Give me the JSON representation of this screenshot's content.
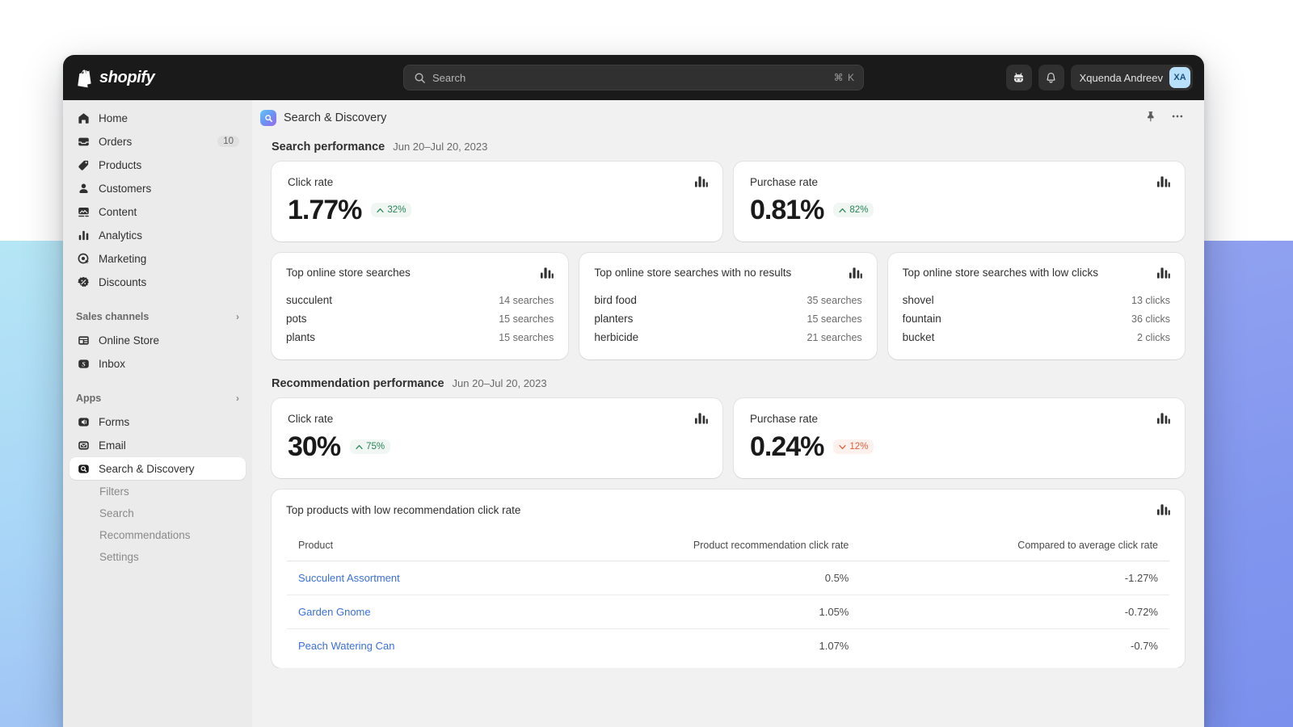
{
  "topbar": {
    "brand": "shopify",
    "search_placeholder": "Search",
    "search_shortcut": "⌘ K",
    "help_icon": "bot-icon",
    "notifications_icon": "bell-icon",
    "user_name": "Xquenda Andreev",
    "user_initials": "XA"
  },
  "sidebar": {
    "items": [
      {
        "label": "Home",
        "icon": "home-icon",
        "badge": ""
      },
      {
        "label": "Orders",
        "icon": "orders-inbox-icon",
        "badge": "10"
      },
      {
        "label": "Products",
        "icon": "tag-icon",
        "badge": ""
      },
      {
        "label": "Customers",
        "icon": "person-icon",
        "badge": ""
      },
      {
        "label": "Content",
        "icon": "content-image-icon",
        "badge": ""
      },
      {
        "label": "Analytics",
        "icon": "bar-chart-icon",
        "badge": ""
      },
      {
        "label": "Marketing",
        "icon": "target-icon",
        "badge": ""
      },
      {
        "label": "Discounts",
        "icon": "discount-badge-icon",
        "badge": ""
      }
    ],
    "sales_channels": {
      "label": "Sales channels",
      "chevron": "›",
      "items": [
        {
          "label": "Online Store",
          "icon": "storefront-icon"
        },
        {
          "label": "Inbox",
          "icon": "inbox-shopify-icon"
        }
      ]
    },
    "apps": {
      "label": "Apps",
      "chevron": "›",
      "items": [
        {
          "label": "Forms",
          "icon": "forms-icon",
          "active": false
        },
        {
          "label": "Email",
          "icon": "email-icon",
          "active": false
        },
        {
          "label": "Search & Discovery",
          "icon": "search-discovery-icon",
          "active": true
        }
      ],
      "subitems": [
        {
          "label": "Filters"
        },
        {
          "label": "Search"
        },
        {
          "label": "Recommendations"
        },
        {
          "label": "Settings"
        }
      ]
    }
  },
  "page": {
    "title": "Search & Discovery",
    "app_icon": "search-discovery-icon",
    "pin_icon": "pin-icon",
    "more_icon": "more-horizontal-icon"
  },
  "search_performance": {
    "title": "Search performance",
    "date_range": "Jun 20–Jul 20, 2023",
    "metrics": [
      {
        "label": "Click rate",
        "value": "1.77%",
        "delta": "32%",
        "direction": "up",
        "chart_icon": "bar-chart-icon"
      },
      {
        "label": "Purchase rate",
        "value": "0.81%",
        "delta": "82%",
        "direction": "up",
        "chart_icon": "bar-chart-icon"
      }
    ],
    "lists": [
      {
        "title": "Top online store searches",
        "chart_icon": "bar-chart-icon",
        "rows": [
          {
            "term": "succulent",
            "count": "14 searches"
          },
          {
            "term": "pots",
            "count": "15 searches"
          },
          {
            "term": "plants",
            "count": "15 searches"
          }
        ]
      },
      {
        "title": "Top online store searches with no results",
        "chart_icon": "bar-chart-icon",
        "rows": [
          {
            "term": "bird food",
            "count": "35 searches"
          },
          {
            "term": "planters",
            "count": "15 searches"
          },
          {
            "term": "herbicide",
            "count": "21 searches"
          }
        ]
      },
      {
        "title": "Top online store searches with low clicks",
        "chart_icon": "bar-chart-icon",
        "rows": [
          {
            "term": "shovel",
            "count": "13 clicks"
          },
          {
            "term": "fountain",
            "count": "36 clicks"
          },
          {
            "term": "bucket",
            "count": "2 clicks"
          }
        ]
      }
    ]
  },
  "recommendation_performance": {
    "title": "Recommendation performance",
    "date_range": "Jun 20–Jul 20, 2023",
    "metrics": [
      {
        "label": "Click rate",
        "value": "30%",
        "delta": "75%",
        "direction": "up",
        "chart_icon": "bar-chart-icon"
      },
      {
        "label": "Purchase rate",
        "value": "0.24%",
        "delta": "12%",
        "direction": "down",
        "chart_icon": "bar-chart-icon"
      }
    ],
    "table": {
      "title": "Top products with low recommendation click rate",
      "chart_icon": "bar-chart-icon",
      "columns": [
        "Product",
        "Product recommendation click rate",
        "Compared to average click rate"
      ],
      "rows": [
        {
          "product": "Succulent Assortment",
          "rate": "0.5%",
          "compared": "-1.27%"
        },
        {
          "product": "Garden Gnome",
          "rate": "1.05%",
          "compared": "-0.72%"
        },
        {
          "product": "Peach Watering Can",
          "rate": "1.07%",
          "compared": "-0.7%"
        }
      ]
    }
  },
  "colors": {
    "topbar_bg": "#1a1a1a",
    "sidebar_bg": "#ebebeb",
    "canvas_bg": "#f1f1f1",
    "positive": "#29845a",
    "negative": "#e0603a",
    "link": "#3a6fd8",
    "accent_avatar": "#b8e0fb"
  }
}
